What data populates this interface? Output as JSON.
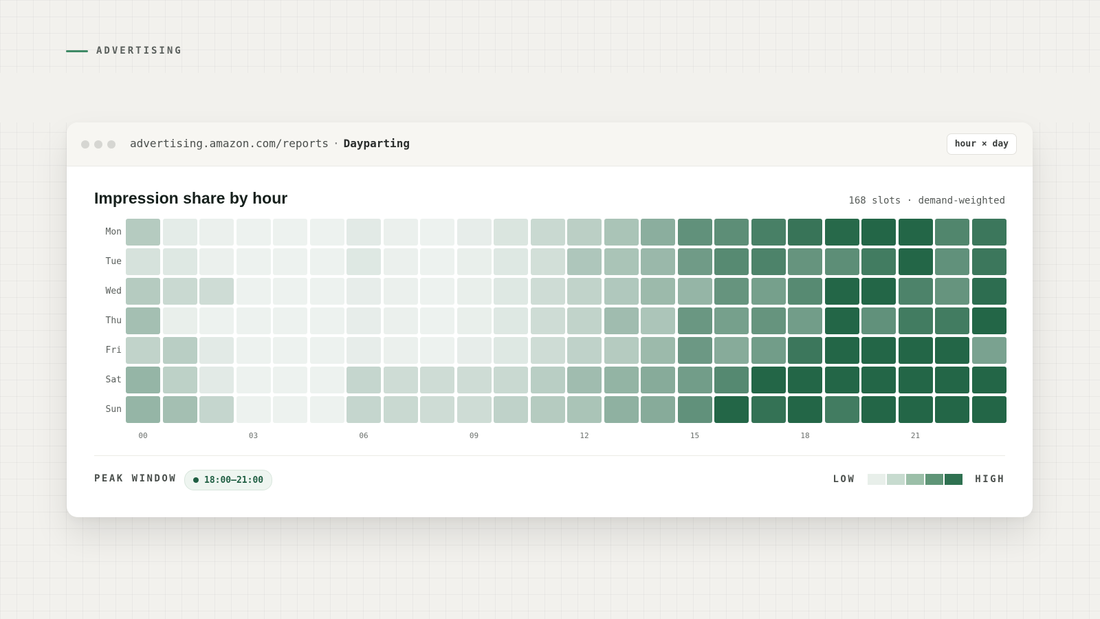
{
  "section": {
    "label": "ADVERTISING"
  },
  "window": {
    "url": "advertising.amazon.com/reports",
    "separator": "·",
    "page": "Dayparting",
    "view_chip": "hour × day"
  },
  "card": {
    "title": "Impression share by hour",
    "subtitle": "168 slots · demand-weighted"
  },
  "footer": {
    "peak_label": "PEAK WINDOW",
    "peak_value": "18:00–21:00",
    "legend_low": "LOW",
    "legend_high": "HIGH",
    "legend_colors": [
      "#e8efea",
      "#c7dbcf",
      "#9bbfa8",
      "#5f9577",
      "#2f7151"
    ]
  },
  "chart_data": {
    "type": "heatmap",
    "title": "Impression share by hour",
    "subtitle": "168 slots · demand-weighted",
    "y_categories": [
      "Mon",
      "Tue",
      "Wed",
      "Thu",
      "Fri",
      "Sat",
      "Sun"
    ],
    "x_categories": [
      0,
      1,
      2,
      3,
      4,
      5,
      6,
      7,
      8,
      9,
      10,
      11,
      12,
      13,
      14,
      15,
      16,
      17,
      18,
      19,
      20,
      21,
      22,
      23
    ],
    "x_tick_labels": [
      "00",
      "03",
      "06",
      "09",
      "12",
      "15",
      "18",
      "21"
    ],
    "x_tick_positions": [
      0,
      3,
      6,
      9,
      12,
      15,
      18,
      21
    ],
    "color_low": "#f3f6f4",
    "color_high": "#236647",
    "values": [
      [
        0.3,
        0.07,
        0.04,
        0.03,
        0.03,
        0.03,
        0.08,
        0.04,
        0.03,
        0.06,
        0.12,
        0.2,
        0.27,
        0.35,
        0.5,
        0.7,
        0.72,
        0.82,
        0.9,
        0.98,
        1.0,
        1.0,
        0.78,
        0.88
      ],
      [
        0.14,
        0.1,
        0.04,
        0.03,
        0.03,
        0.03,
        0.1,
        0.04,
        0.03,
        0.05,
        0.1,
        0.16,
        0.33,
        0.35,
        0.43,
        0.63,
        0.75,
        0.8,
        0.68,
        0.72,
        0.85,
        1.0,
        0.7,
        0.88
      ],
      [
        0.3,
        0.2,
        0.18,
        0.03,
        0.03,
        0.03,
        0.06,
        0.04,
        0.03,
        0.05,
        0.1,
        0.18,
        0.24,
        0.32,
        0.42,
        0.45,
        0.68,
        0.6,
        0.75,
        1.0,
        1.0,
        0.8,
        0.68,
        0.95
      ],
      [
        0.38,
        0.05,
        0.03,
        0.03,
        0.03,
        0.03,
        0.06,
        0.04,
        0.03,
        0.05,
        0.1,
        0.18,
        0.24,
        0.4,
        0.34,
        0.66,
        0.6,
        0.68,
        0.62,
        1.0,
        0.7,
        0.85,
        0.85,
        1.0
      ],
      [
        0.24,
        0.28,
        0.08,
        0.03,
        0.03,
        0.03,
        0.06,
        0.04,
        0.03,
        0.06,
        0.1,
        0.18,
        0.25,
        0.3,
        0.42,
        0.65,
        0.52,
        0.62,
        0.88,
        1.0,
        1.0,
        1.0,
        1.0,
        0.58
      ],
      [
        0.45,
        0.26,
        0.08,
        0.03,
        0.03,
        0.03,
        0.22,
        0.18,
        0.18,
        0.18,
        0.2,
        0.28,
        0.4,
        0.46,
        0.52,
        0.62,
        0.76,
        1.0,
        1.0,
        1.0,
        1.0,
        1.0,
        1.0,
        1.0
      ],
      [
        0.45,
        0.38,
        0.22,
        0.03,
        0.03,
        0.03,
        0.22,
        0.2,
        0.18,
        0.18,
        0.25,
        0.3,
        0.35,
        0.48,
        0.52,
        0.7,
        1.0,
        0.92,
        1.0,
        0.85,
        1.0,
        1.0,
        1.0,
        1.0
      ]
    ]
  }
}
